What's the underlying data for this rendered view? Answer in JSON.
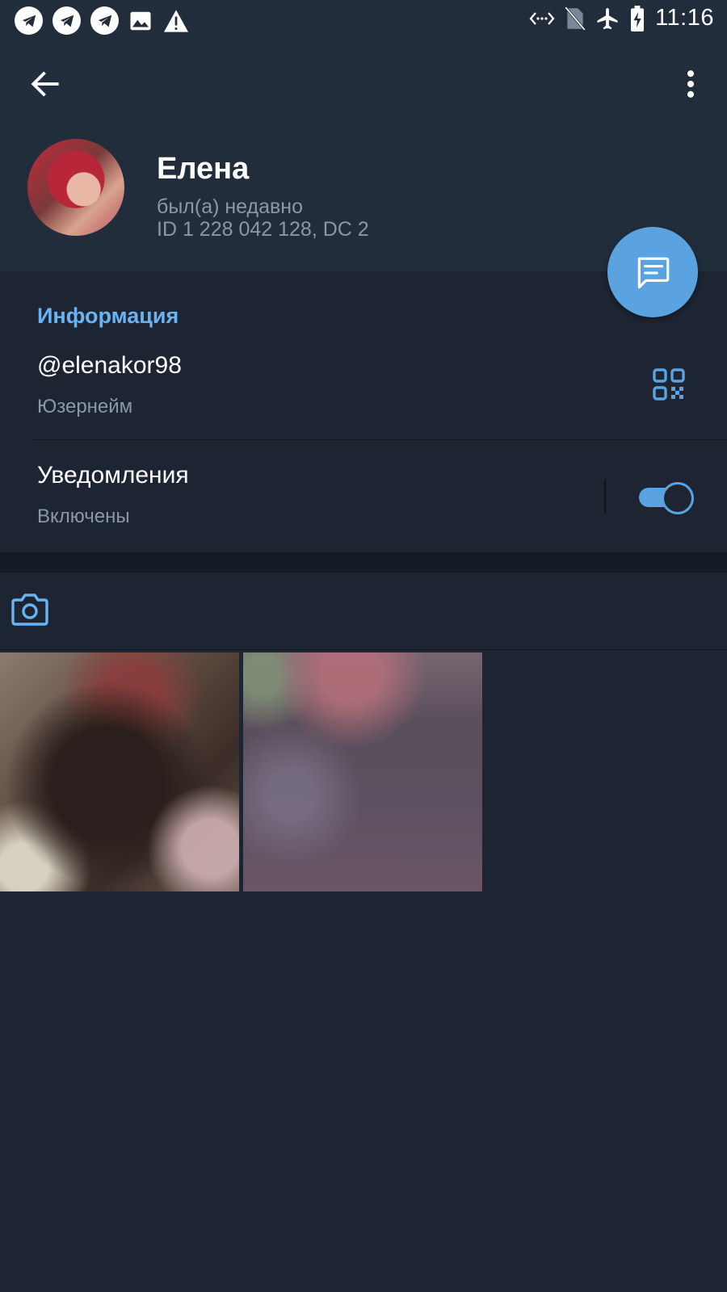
{
  "status_bar": {
    "time": "11:16",
    "left_icons": [
      "telegram-icon",
      "telegram-icon",
      "telegram-icon",
      "image-icon",
      "warning-icon"
    ],
    "right_icons": [
      "data-transfer-icon",
      "no-sim-icon",
      "airplane-icon",
      "battery-charging-icon"
    ]
  },
  "header": {
    "name": "Елена",
    "last_seen": "был(а) недавно",
    "id_line": "ID 1 228 042 128, DC 2"
  },
  "info": {
    "section_title": "Информация",
    "username": "@elenakor98",
    "username_label": "Юзернейм",
    "notifications_title": "Уведомления",
    "notifications_value": "Включены",
    "notifications_enabled": true
  },
  "media": {
    "active_tab": "photos",
    "photo_count": 2
  },
  "colors": {
    "accent": "#5aa3e0",
    "section_title": "#6ab3f3",
    "background": "#1d2533",
    "header_bg": "#222d3c",
    "secondary_text": "#8a97a8"
  }
}
